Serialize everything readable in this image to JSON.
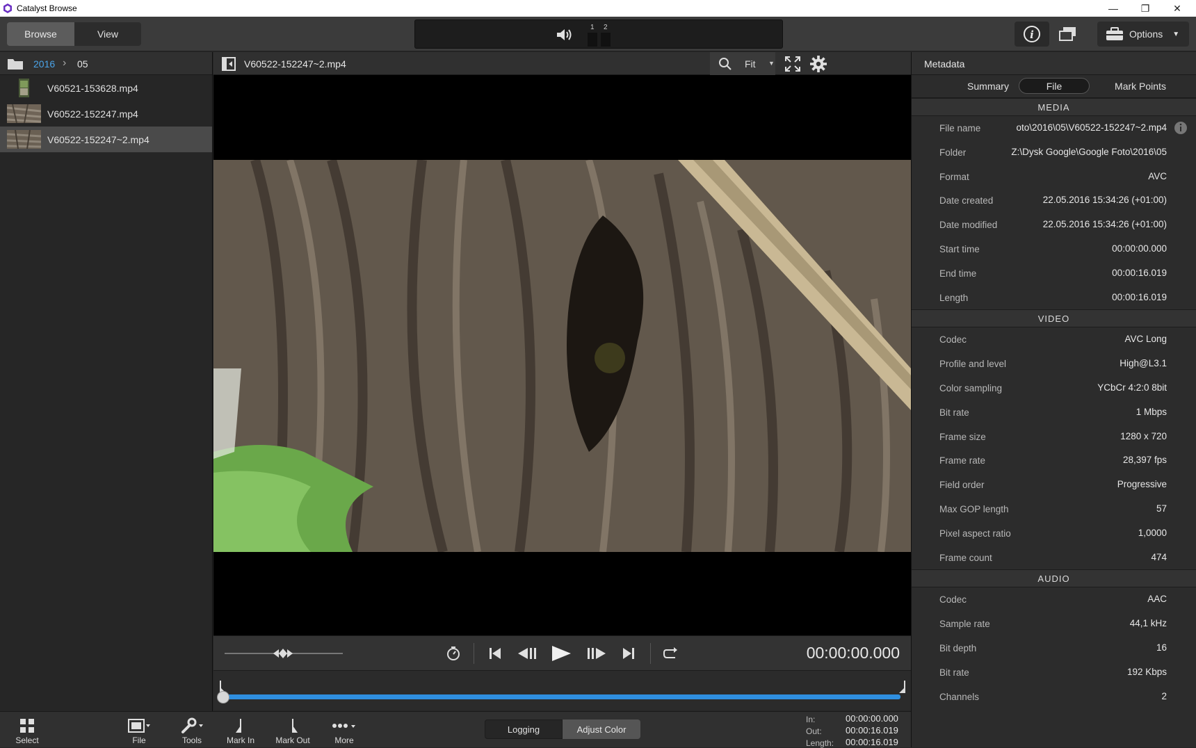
{
  "window": {
    "title": "Catalyst Browse",
    "minimize": "—",
    "restore": "❐",
    "close": "✕"
  },
  "toolbar": {
    "browse": "Browse",
    "view": "View",
    "meter_labels": [
      "1",
      "2"
    ],
    "info_icon": "i",
    "options": "Options"
  },
  "breadcrumb": {
    "items": [
      "2016",
      "05"
    ],
    "separator": "›"
  },
  "files": [
    {
      "name": "V60521-153628.mp4",
      "selected": false
    },
    {
      "name": "V60522-152247.mp4",
      "selected": false
    },
    {
      "name": "V60522-152247~2.mp4",
      "selected": true
    }
  ],
  "viewer": {
    "clip_name": "V60522-152247~2.mp4",
    "zoom": "Fit",
    "timecode": "00:00:00.000",
    "playhead_fraction": 0.0
  },
  "metadata": {
    "title": "Metadata",
    "tabs": [
      {
        "label": "Summary",
        "active": false
      },
      {
        "label": "File",
        "active": true
      },
      {
        "label": "Mark Points",
        "active": false
      }
    ],
    "sections": [
      {
        "name": "MEDIA",
        "rows": [
          {
            "k": "File name",
            "v": "oto\\2016\\05\\V60522-152247~2.mp4"
          },
          {
            "k": "Folder",
            "v": "Z:\\Dysk Google\\Google Foto\\2016\\05"
          },
          {
            "k": "Format",
            "v": "AVC"
          },
          {
            "k": "Date created",
            "v": "22.05.2016 15:34:26 (+01:00)"
          },
          {
            "k": "Date modified",
            "v": "22.05.2016 15:34:26 (+01:00)"
          },
          {
            "k": "Start time",
            "v": "00:00:00.000"
          },
          {
            "k": "End time",
            "v": "00:00:16.019"
          },
          {
            "k": "Length",
            "v": "00:00:16.019"
          }
        ]
      },
      {
        "name": "VIDEO",
        "rows": [
          {
            "k": "Codec",
            "v": "AVC Long"
          },
          {
            "k": "Profile and level",
            "v": "High@L3.1"
          },
          {
            "k": "Color sampling",
            "v": "YCbCr 4:2:0 8bit"
          },
          {
            "k": "Bit rate",
            "v": "1 Mbps"
          },
          {
            "k": "Frame size",
            "v": "1280 x 720"
          },
          {
            "k": "Frame rate",
            "v": "28,397 fps"
          },
          {
            "k": "Field order",
            "v": "Progressive"
          },
          {
            "k": "Max GOP length",
            "v": "57"
          },
          {
            "k": "Pixel aspect ratio",
            "v": "1,0000"
          },
          {
            "k": "Frame count",
            "v": "474"
          }
        ]
      },
      {
        "name": "AUDIO",
        "rows": [
          {
            "k": "Codec",
            "v": "AAC"
          },
          {
            "k": "Sample rate",
            "v": "44,1 kHz"
          },
          {
            "k": "Bit depth",
            "v": "16"
          },
          {
            "k": "Bit rate",
            "v": "192 Kbps"
          },
          {
            "k": "Channels",
            "v": "2"
          }
        ]
      }
    ]
  },
  "bottombar": {
    "select": "Select",
    "file": "File",
    "tools": "Tools",
    "mark_in": "Mark In",
    "mark_out": "Mark Out",
    "more": "More",
    "logging": "Logging",
    "adjust_color": "Adjust Color",
    "in_label": "In:",
    "in_value": "00:00:00.000",
    "out_label": "Out:",
    "out_value": "00:00:16.019",
    "length_label": "Length:",
    "length_value": "00:00:16.019"
  },
  "colors": {
    "accent": "#2f8fe0",
    "crumb_link": "#4aa3e8",
    "panel": "#2c2c2c",
    "selected_row": "#4a4a4a"
  }
}
